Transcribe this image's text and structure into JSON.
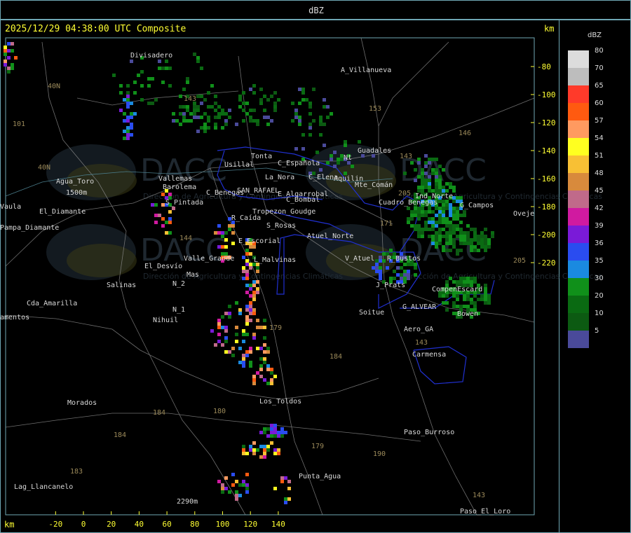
{
  "top_title": "dBZ",
  "header": "2025/12/29 04:38:00 UTC Composite",
  "km_top": "km",
  "km_bottom": "km",
  "x_ticks": [
    "-20",
    "0",
    "20",
    "40",
    "60",
    "80",
    "100",
    "120",
    "140"
  ],
  "y_ticks": [
    "-80",
    "-100",
    "-120",
    "-140",
    "-160",
    "-180",
    "-200",
    "-220"
  ],
  "legend": {
    "title": "dBZ",
    "levels": [
      {
        "label": "80",
        "color": "#dcdcdc"
      },
      {
        "label": "70",
        "color": "#bdbdbd"
      },
      {
        "label": "65",
        "color": "#ff3a2a"
      },
      {
        "label": "60",
        "color": "#ff5a10"
      },
      {
        "label": "57",
        "color": "#ff9a60"
      },
      {
        "label": "54",
        "color": "#ffff20"
      },
      {
        "label": "51",
        "color": "#f8c034"
      },
      {
        "label": "48",
        "color": "#d88a3c"
      },
      {
        "label": "45",
        "color": "#c06a8a"
      },
      {
        "label": "42",
        "color": "#d01aa0"
      },
      {
        "label": "39",
        "color": "#7a1ad8"
      },
      {
        "label": "36",
        "color": "#2a4cf0"
      },
      {
        "label": "35",
        "color": "#1a8ae0"
      },
      {
        "label": "30",
        "color": "#10901a"
      },
      {
        "label": "20",
        "color": "#0a6a12"
      },
      {
        "label": "10",
        "color": "#0c5a12"
      },
      {
        "label": "5",
        "color": "#4a4a9a"
      }
    ]
  },
  "places": [
    {
      "name": "Divisadero"
    },
    {
      "name": "A_Villanueva"
    },
    {
      "name": "Guadales"
    },
    {
      "name": "Usillal"
    },
    {
      "name": "Tonta"
    },
    {
      "name": "C_Española"
    },
    {
      "name": "La_Nora"
    },
    {
      "name": "C_Elena"
    },
    {
      "name": "Aquilin"
    },
    {
      "name": "Mte_Comán"
    },
    {
      "name": "Agua_Toro"
    },
    {
      "name": "1500m"
    },
    {
      "name": "Vallemas"
    },
    {
      "name": "Barolema"
    },
    {
      "name": "C_Benegas"
    },
    {
      "name": "SAN_RAFAEL"
    },
    {
      "name": "E_Algarrobal"
    },
    {
      "name": "C_Bombal"
    },
    {
      "name": "Vaula"
    },
    {
      "name": "El_Diamante"
    },
    {
      "name": "S_Pintada"
    },
    {
      "name": "Tropezon_Goudge"
    },
    {
      "name": "G_Campos"
    },
    {
      "name": "Oveje"
    },
    {
      "name": "Pampa_Diamante"
    },
    {
      "name": "R_Caída"
    },
    {
      "name": "S_Rosas"
    },
    {
      "name": "Atuel_Norte"
    },
    {
      "name": "Cuadro_Benegas"
    },
    {
      "name": "E_Escorial"
    },
    {
      "name": "El_Desvío"
    },
    {
      "name": "Valle_Grande"
    },
    {
      "name": "L_Malvinas"
    },
    {
      "name": "V_Atuel"
    },
    {
      "name": "R_Bustos"
    },
    {
      "name": "Salinas"
    },
    {
      "name": "N_2"
    },
    {
      "name": "J_Prats"
    },
    {
      "name": "CompenEscard"
    },
    {
      "name": "Cda_Amarilla"
    },
    {
      "name": "N_1"
    },
    {
      "name": "Nihuil"
    },
    {
      "name": "G_ALVEAR"
    },
    {
      "name": "Bowen"
    },
    {
      "name": "Soitue"
    },
    {
      "name": "Aero_GA"
    },
    {
      "name": "amentos"
    },
    {
      "name": "Carmensa"
    },
    {
      "name": "Morados"
    },
    {
      "name": "Los_Toldos"
    },
    {
      "name": "Paso_Burroso"
    },
    {
      "name": "Lag_Llancanelo"
    },
    {
      "name": "Punta_Agua"
    },
    {
      "name": "2290m"
    },
    {
      "name": "Paso_El_Loro"
    },
    {
      "name": "Ind_Norte"
    },
    {
      "name": "Mas"
    },
    {
      "name": "Nt"
    }
  ],
  "route_labels": [
    "40N",
    "101",
    "143",
    "153",
    "146",
    "40N",
    "143",
    "171",
    "205",
    "144",
    "205",
    "179",
    "184",
    "180",
    "184",
    "184",
    "183",
    "179",
    "190",
    "143",
    "143"
  ],
  "watermarks": [
    {
      "brand": "DACC",
      "subtitle": "Dirección de Agricultura y Contingencias Climáticas"
    }
  ]
}
